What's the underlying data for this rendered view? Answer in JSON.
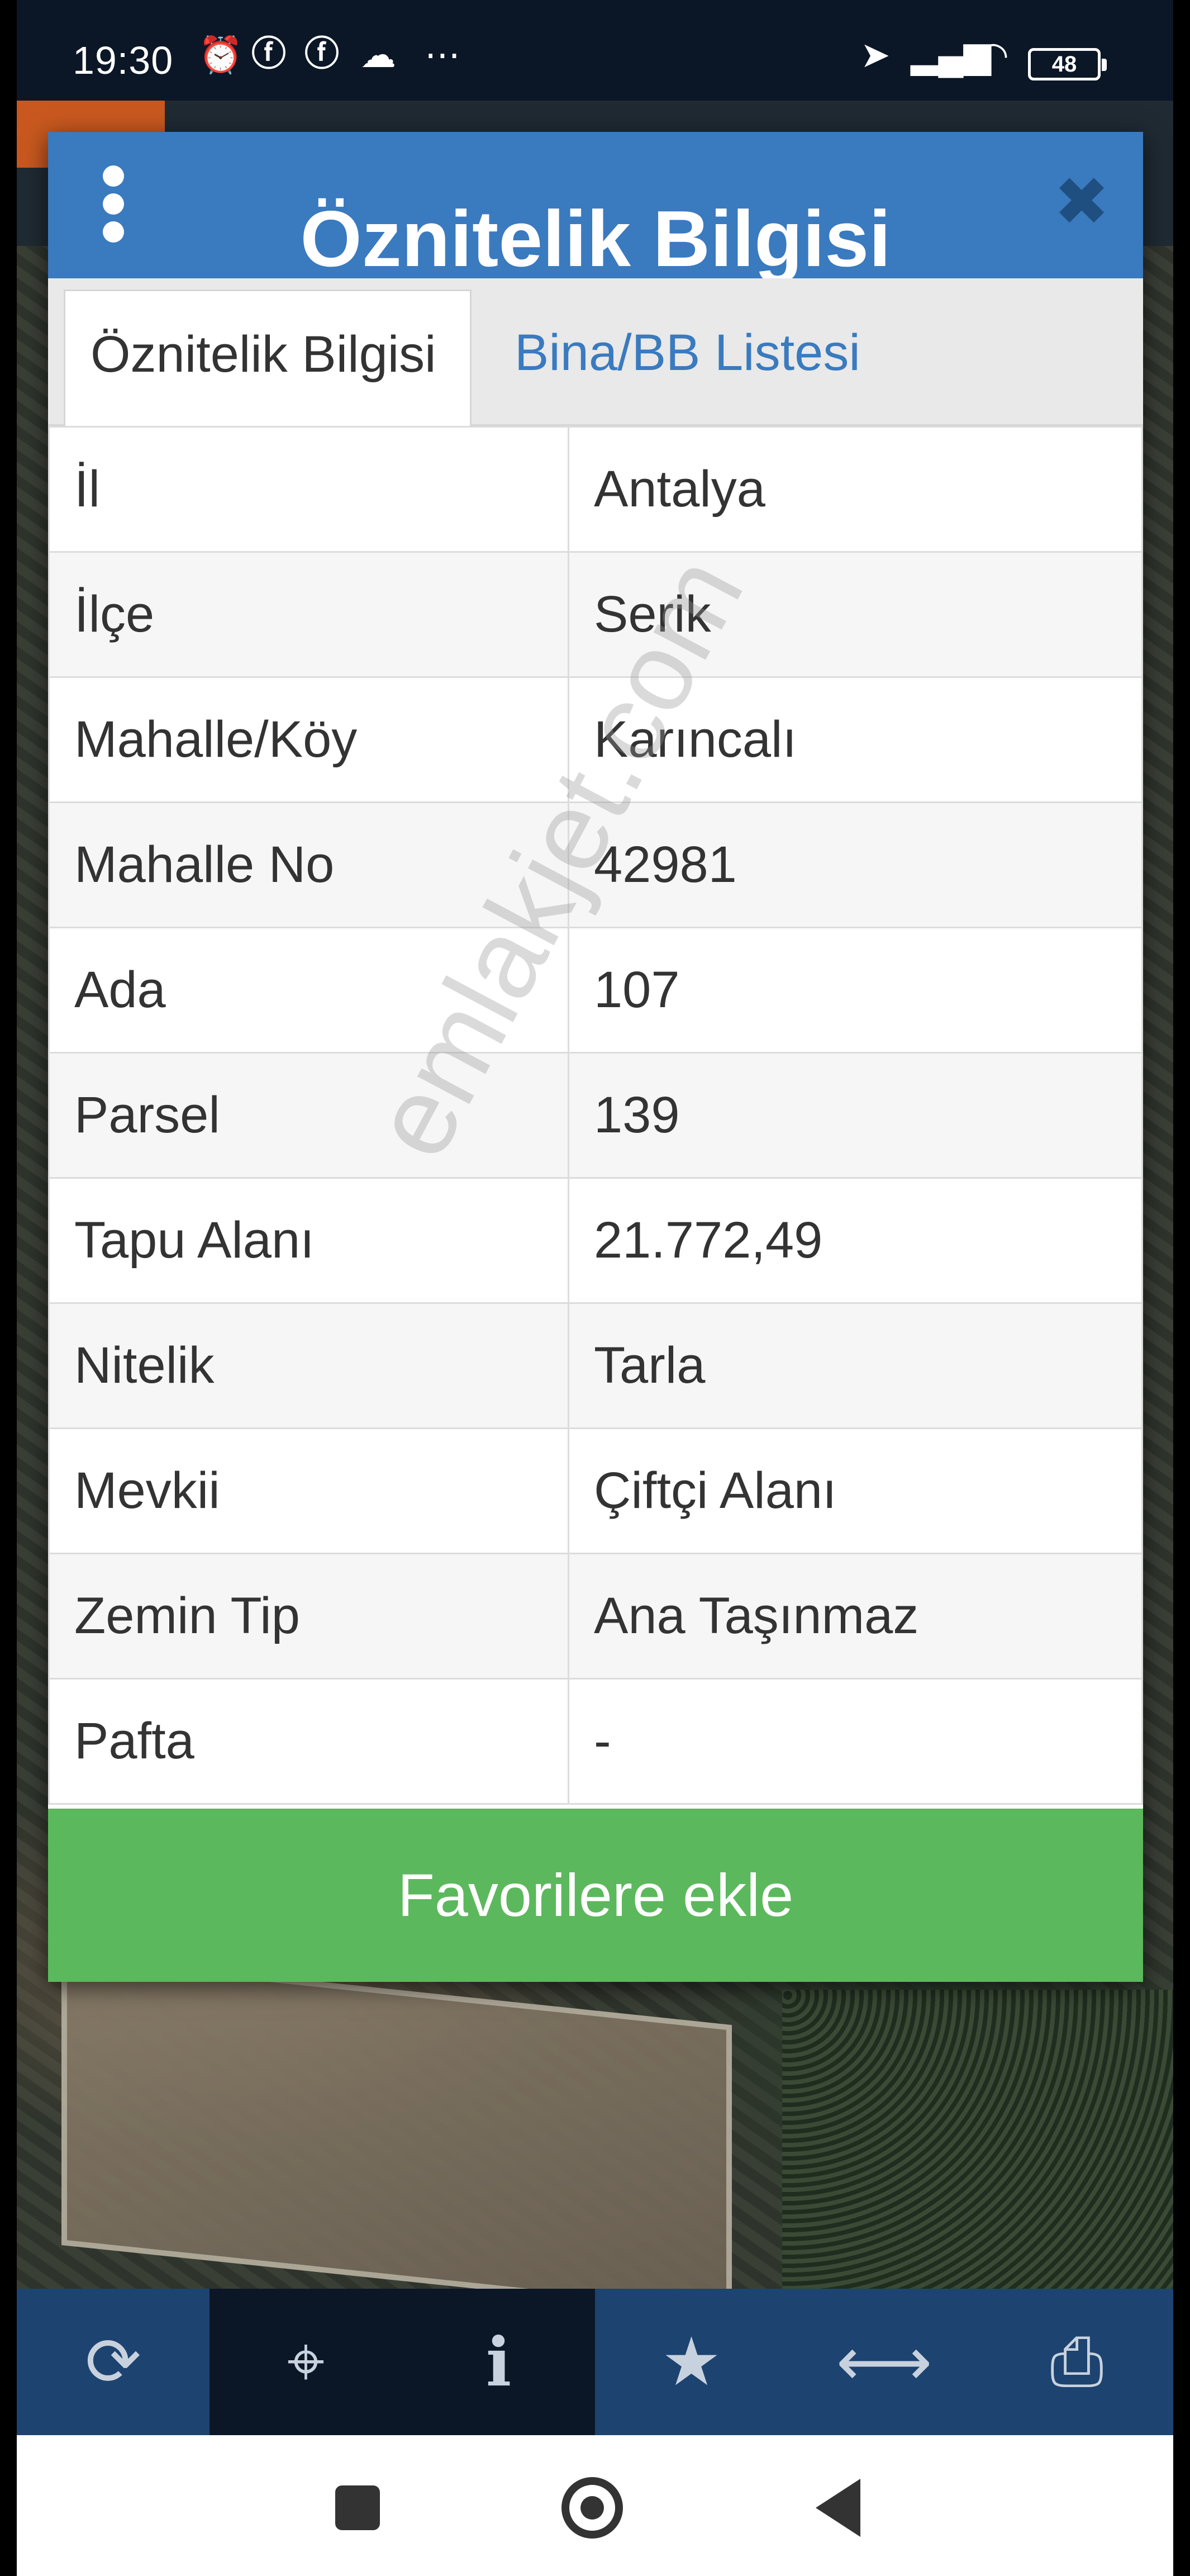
{
  "status_bar": {
    "time": "19:30",
    "icons_left": [
      "alarm-icon",
      "facebook-icon",
      "facebook-icon",
      "cloud-icon",
      "more-icon"
    ],
    "icons_right": [
      "location-icon",
      "signal-icon",
      "wifi-icon"
    ],
    "battery": "48"
  },
  "dialog": {
    "title": "Öznitelik Bilgisi",
    "tabs": [
      {
        "label": "Öznitelik Bilgisi",
        "active": true
      },
      {
        "label": "Bina/BB Listesi",
        "active": false
      }
    ],
    "rows": [
      {
        "key": "İl",
        "value": "Antalya"
      },
      {
        "key": "İlçe",
        "value": "Serik"
      },
      {
        "key": "Mahalle/Köy",
        "value": "Karıncalı"
      },
      {
        "key": "Mahalle No",
        "value": "42981"
      },
      {
        "key": "Ada",
        "value": "107"
      },
      {
        "key": "Parsel",
        "value": "139"
      },
      {
        "key": "Tapu Alanı",
        "value": "21.772,49"
      },
      {
        "key": "Nitelik",
        "value": "Tarla"
      },
      {
        "key": "Mevkii",
        "value": "Çiftçi Alanı"
      },
      {
        "key": "Zemin Tip",
        "value": "Ana Taşınmaz"
      },
      {
        "key": "Pafta",
        "value": "-"
      }
    ],
    "favorite_button": "Favorilere ekle"
  },
  "toolbar": {
    "tools": [
      "refresh-icon",
      "locate-icon",
      "info-icon",
      "star-icon",
      "measure-icon",
      "print-icon"
    ]
  },
  "watermark": "emlakjet.com",
  "colors": {
    "header": "#3a7abf",
    "button": "#5cb85c",
    "toolbar": "#1d4370"
  }
}
